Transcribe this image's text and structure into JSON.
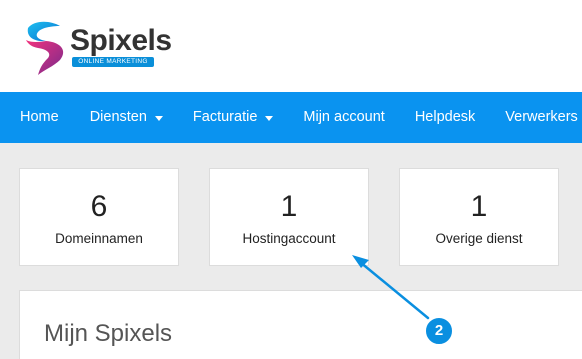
{
  "brand": {
    "name": "Spixels",
    "tagline": "ONLINE MARKETING",
    "colors": {
      "pink": "#e6287a",
      "purple": "#7a2a8c",
      "blue": "#0a8fd9"
    }
  },
  "nav": {
    "background": "#0a93f0",
    "items": [
      {
        "label": "Home",
        "has_dropdown": false
      },
      {
        "label": "Diensten",
        "has_dropdown": true
      },
      {
        "label": "Facturatie",
        "has_dropdown": true
      },
      {
        "label": "Mijn account",
        "has_dropdown": false
      },
      {
        "label": "Helpdesk",
        "has_dropdown": false
      },
      {
        "label": "Verwerkers",
        "has_dropdown": false
      }
    ]
  },
  "stats": [
    {
      "value": "6",
      "label": "Domeinnamen"
    },
    {
      "value": "1",
      "label": "Hostingaccount"
    },
    {
      "value": "1",
      "label": "Overige dienst"
    }
  ],
  "panel": {
    "title": "Mijn Spixels"
  },
  "annotation": {
    "step": "2",
    "color": "#0a8fe0"
  }
}
